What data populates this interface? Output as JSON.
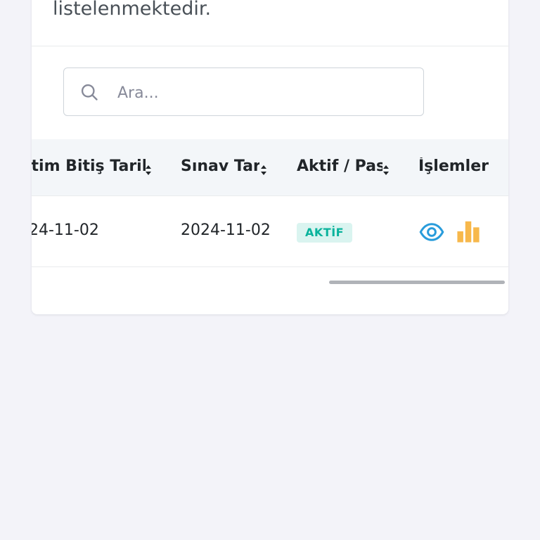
{
  "card": {
    "description": "listelenmektedir."
  },
  "search": {
    "placeholder": "Ara..."
  },
  "table": {
    "headers": [
      "itim Bitiş Tarihi",
      "Sınav Tar",
      "Aktif / Pasif",
      "İşlemler"
    ],
    "rows": [
      {
        "end_date": "24-11-02",
        "exam_date": "2024-11-02",
        "status": "AKTİF"
      }
    ]
  },
  "icons": {
    "search": "search-icon",
    "sort": "sort-icon",
    "view": "eye-icon",
    "stats": "bar-chart-icon"
  },
  "colors": {
    "status_badge_bg": "#daf4f0",
    "status_badge_text": "#0ab39c",
    "view_icon": "#299cdb",
    "stats_icon": "#f7b84b"
  }
}
